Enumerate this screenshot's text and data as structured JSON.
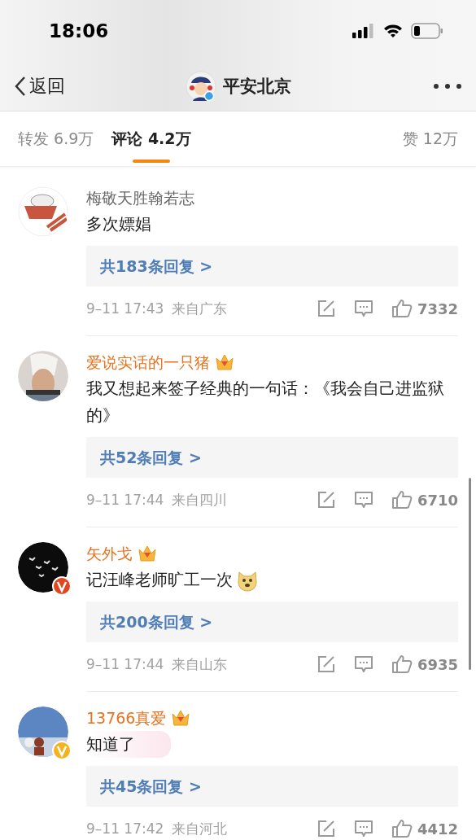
{
  "status_bar": {
    "time": "18:06"
  },
  "nav": {
    "back_label": "返回",
    "title": "平安北京"
  },
  "tabs": [
    {
      "label": "转发 6.9万",
      "selected": false
    },
    {
      "label": "评论 4.2万",
      "selected": true
    },
    {
      "label": "赞 12万",
      "selected": false
    }
  ],
  "comments": [
    {
      "author": "梅敬天胜翰若志",
      "vip": false,
      "text": "多次嫖娼",
      "replies": "共183条回复 >",
      "time": "9–11 17:43",
      "location": "来自广东",
      "likes": "7332"
    },
    {
      "author": "爱说实话的一只猪",
      "vip": true,
      "text": "我又想起来签子经典的一句话：《我会自己进监狱的》",
      "replies": "共52条回复 >",
      "time": "9–11 17:44",
      "location": "来自四川",
      "likes": "6710"
    },
    {
      "author": "矢外戈",
      "vip": true,
      "color": "#e2461f",
      "emoji": true,
      "text": "记汪峰老师旷工一次",
      "replies": "共200条回复 >",
      "time": "9–11 17:44",
      "location": "来自山东",
      "likes": "6935"
    },
    {
      "author": "13766真爱",
      "vip": true,
      "color": "#f5b21c",
      "highlighted": true,
      "text": "知道了",
      "replies": "共45条回复 >",
      "time": "9–11 17:42",
      "location": "来自河北",
      "likes": "4412"
    }
  ]
}
